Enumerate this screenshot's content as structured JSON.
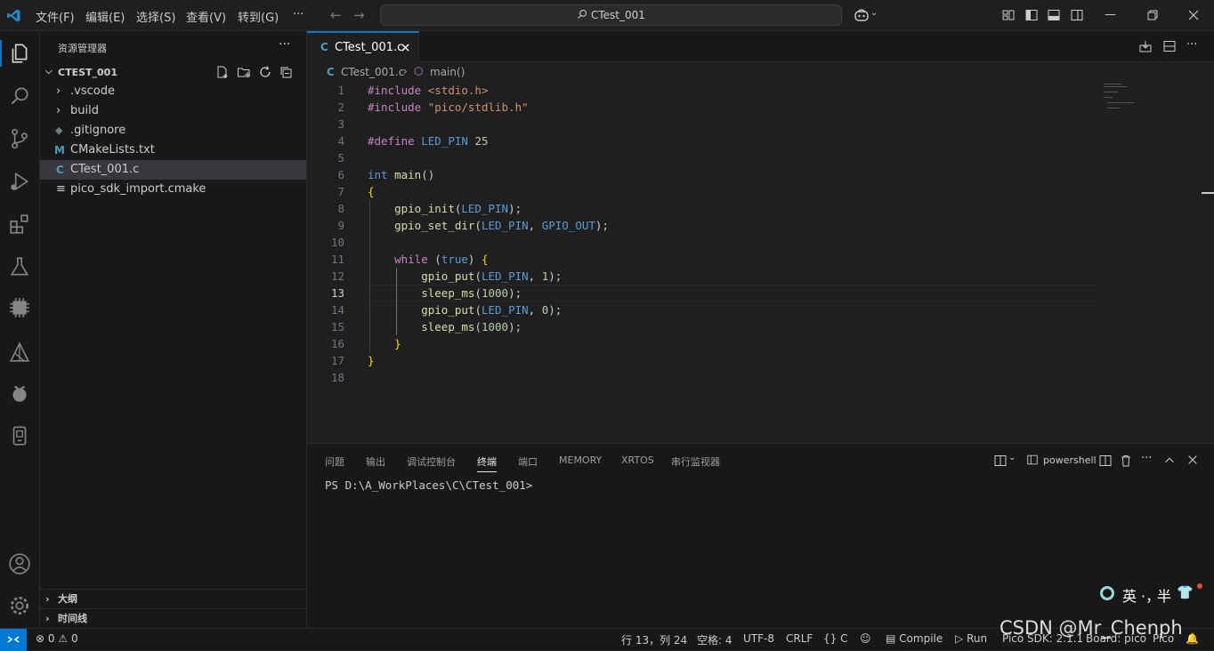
{
  "titlebar": {
    "menus": [
      "文件(F)",
      "编辑(E)",
      "选择(S)",
      "查看(V)",
      "转到(G)",
      "···"
    ],
    "search_text": "CTest_001",
    "icons": [
      "vscode-logo-icon",
      "back-arrow-icon",
      "forward-arrow-icon",
      "search-icon",
      "copilot-icon",
      "customize-layout-icon",
      "toggle-sidebar-icon",
      "toggle-panel-icon",
      "toggle-secondary-sidebar-icon",
      "minimize-icon",
      "restore-icon",
      "close-icon"
    ]
  },
  "activity_bar": {
    "items": [
      "explorer-icon",
      "search-icon",
      "source-control-icon",
      "run-debug-icon",
      "extensions-icon",
      "testing-icon",
      "chip-icon",
      "cmake-icon",
      "raspberry-icon",
      "device-icon"
    ],
    "bottom": [
      "account-icon",
      "settings-gear-icon"
    ]
  },
  "sidebar": {
    "title": "资源管理器",
    "more": "···",
    "folder": "CTEST_001",
    "items": [
      {
        "label": ".vscode",
        "type": "folder"
      },
      {
        "label": "build",
        "type": "folder"
      },
      {
        "label": ".gitignore",
        "type": "file"
      },
      {
        "label": "CMakeLists.txt",
        "type": "file"
      },
      {
        "label": "CTest_001.c",
        "type": "file"
      },
      {
        "label": "pico_sdk_import.cmake",
        "type": "file"
      }
    ],
    "outline": "大纲",
    "timeline": "时间线"
  },
  "editor": {
    "tab_label": "CTest_001.c",
    "tab_icon_letter": "C",
    "breadcrumb_file": "CTest_001.c",
    "breadcrumb_symbol": "main()",
    "lines": [
      "#include <stdio.h>",
      "#include \"pico/stdlib.h\"",
      "",
      "#define LED_PIN 25",
      "",
      "int main()",
      "{",
      "    gpio_init(LED_PIN);",
      "    gpio_set_dir(LED_PIN, GPIO_OUT);",
      "",
      "    while (true) {",
      "        gpio_put(LED_PIN, 1);",
      "        sleep_ms(1000);",
      "        gpio_put(LED_PIN, 0);",
      "        sleep_ms(1000);",
      "    }",
      "}",
      ""
    ],
    "active_line": 13
  },
  "panel": {
    "tabs": [
      "问题",
      "输出",
      "调试控制台",
      "终端",
      "端口",
      "MEMORY",
      "XRTOS",
      "串行监视器"
    ],
    "active_tab": "终端",
    "terminal_name": "powershell",
    "terminal_prompt": "PS D:\\A_WorkPlaces\\C\\CTest_001>"
  },
  "statusbar": {
    "errors": "0",
    "warnings": "0",
    "position": "行 13，列 24",
    "spaces": "空格: 4",
    "encoding": "UTF-8",
    "eol": "CRLF",
    "language": "C",
    "compile": "Compile",
    "run": "Run",
    "sdk": "Pico SDK: 2.1.1",
    "board": "Board: pico",
    "pico": "Pico"
  },
  "ime": {
    "mode": "英",
    "punct": "·，",
    "width": "半"
  },
  "watermark": "CSDN @Mr_Chenph",
  "colors": {
    "accent": "#0078d4",
    "background": "#1f1f1f",
    "sidebar": "#181818"
  }
}
